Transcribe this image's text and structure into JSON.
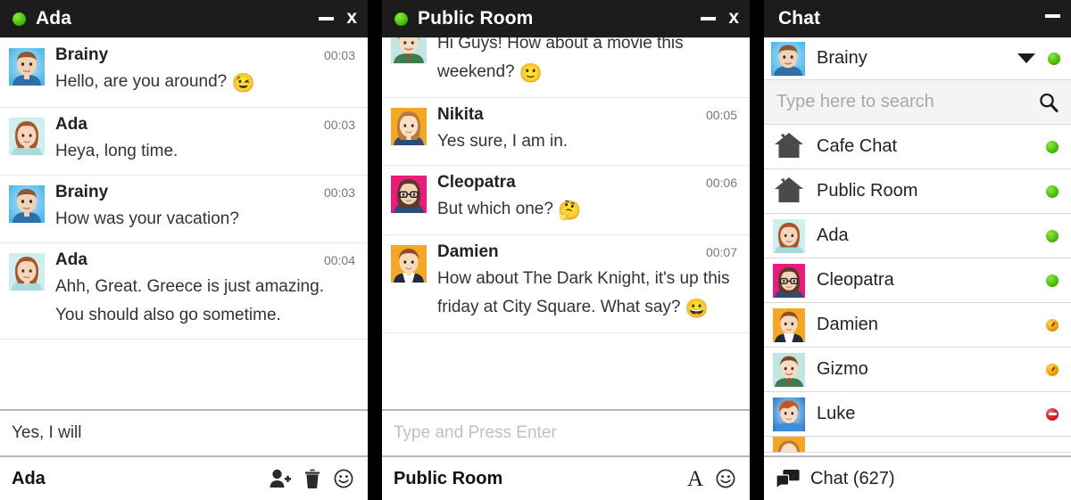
{
  "windows": {
    "chat_ada": {
      "title": "Ada",
      "status": "online",
      "minimize_label": "_",
      "close_label": "x",
      "messages": [
        {
          "sender": "Brainy",
          "time": "00:03",
          "text": "Hello, are you around? ",
          "emoji": "wink",
          "avatar": "brainy"
        },
        {
          "sender": "Ada",
          "time": "00:03",
          "text": "Heya, long time.",
          "emoji": "",
          "avatar": "ada"
        },
        {
          "sender": "Brainy",
          "time": "00:03",
          "text": "How was your vacation?",
          "emoji": "",
          "avatar": "brainy"
        },
        {
          "sender": "Ada",
          "time": "00:04",
          "text": "Ahh, Great. Greece is just amazing. You should also go sometime.",
          "emoji": "",
          "avatar": "ada"
        }
      ],
      "compose_value": "Yes, I will",
      "footer_name": "Ada",
      "footer_icons": [
        "add-user-icon",
        "trash-icon",
        "smiley-icon"
      ]
    },
    "public_room": {
      "title": "Public Room",
      "status": "online",
      "minimize_label": "_",
      "close_label": "x",
      "messages": [
        {
          "sender": "",
          "time": "",
          "text": "Hi Guys! How about a movie this weekend? ",
          "emoji": "smile",
          "avatar": "gizmo",
          "continued": true
        },
        {
          "sender": "Nikita",
          "time": "00:05",
          "text": "Yes sure, I am in.",
          "emoji": "",
          "avatar": "nikita"
        },
        {
          "sender": "Cleopatra",
          "time": "00:06",
          "text": "But which one? ",
          "emoji": "think",
          "avatar": "cleopatra"
        },
        {
          "sender": "Damien",
          "time": "00:07",
          "text": "How about The Dark Knight, it's up this friday at City Square. What say? ",
          "emoji": "grin",
          "avatar": "damien"
        }
      ],
      "compose_placeholder": "Type and Press Enter",
      "compose_value": "",
      "footer_name": "Public Room",
      "footer_icons": [
        "font-icon",
        "smiley-icon"
      ],
      "font_icon_label": "A"
    },
    "contacts_panel": {
      "title": "Chat",
      "minimize_label": "_",
      "me": {
        "name": "Brainy",
        "status": "online",
        "avatar": "brainy"
      },
      "search_placeholder": "Type here to search",
      "search_value": "",
      "contacts": [
        {
          "name": "Cafe Chat",
          "status": "online",
          "avatar": "room"
        },
        {
          "name": "Public Room",
          "status": "online",
          "avatar": "room"
        },
        {
          "name": "Ada",
          "status": "online",
          "avatar": "ada"
        },
        {
          "name": "Cleopatra",
          "status": "online",
          "avatar": "cleopatra"
        },
        {
          "name": "Damien",
          "status": "away",
          "avatar": "damien"
        },
        {
          "name": "Gizmo",
          "status": "away",
          "avatar": "gizmo"
        },
        {
          "name": "Luke",
          "status": "busy",
          "avatar": "luke"
        },
        {
          "name": "",
          "status": "",
          "avatar": "nikita",
          "partial": true
        }
      ],
      "footer_label": "Chat (627)",
      "footer_icon": "chat-bubbles-icon"
    }
  },
  "colors": {
    "titlebar": "#1c1c1c",
    "online": "#4cc20a",
    "away": "#f2a008",
    "busy": "#d62020",
    "placeholder": "#c0c0c0",
    "divider": "#e6e6e6"
  }
}
